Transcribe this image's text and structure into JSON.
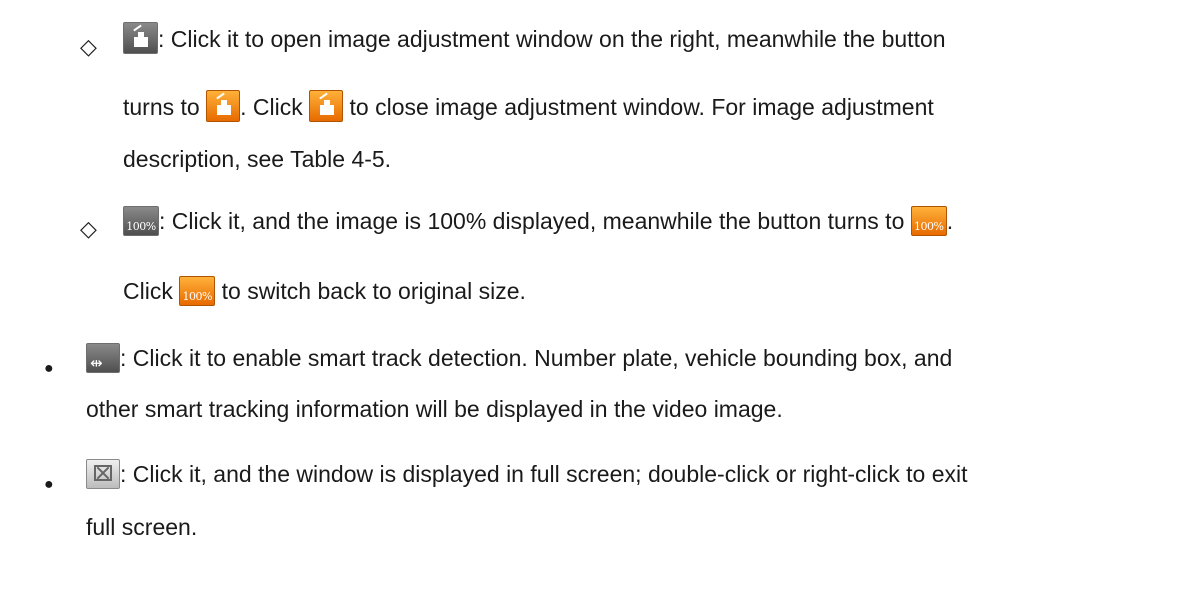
{
  "bullets": {
    "diamond": "◇",
    "dot": "●"
  },
  "items": {
    "image_adjust": {
      "line1": ": Click it to open image adjustment window on the right, meanwhile the button",
      "line2_a": "turns to",
      "line2_b": ". Click",
      "line2_c": "to close image adjustment window. For image adjustment",
      "line3": "description, see Table 4-5."
    },
    "zoom_100": {
      "icon_text": "100%",
      "line1": ": Click it, and the image is 100% displayed, meanwhile the button turns to",
      "line1_end": ".",
      "line2_a": "Click",
      "line2_b": "to switch back to original size."
    },
    "smart_track": {
      "icon_glyph": "⇹",
      "line1": ": Click it to enable smart track detection. Number plate, vehicle bounding box, and",
      "line2": "other smart tracking information will be displayed in the video image."
    },
    "fullscreen": {
      "line1": ": Click it, and the window is displayed in full screen; double-click or right-click to exit",
      "line2": "full screen."
    }
  },
  "colors": {
    "orange": "#e76a00",
    "gray": "#5a5a5a"
  }
}
